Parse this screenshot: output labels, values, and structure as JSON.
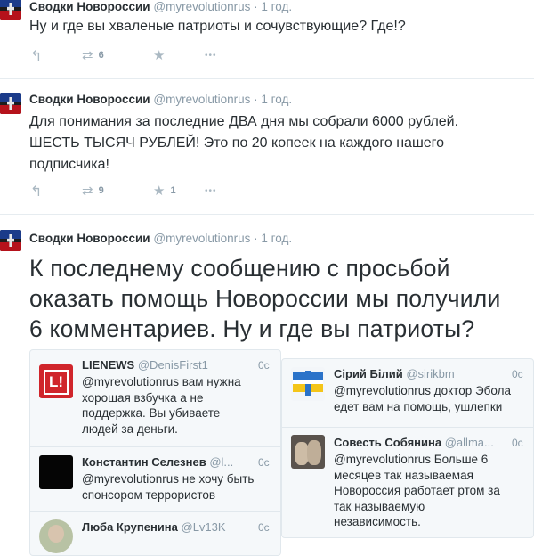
{
  "tweets": [
    {
      "name": "Сводки Новороссии",
      "handle": "@myrevolutionrus",
      "dot": "·",
      "time": "1 год.",
      "text": "Ну и где вы хваленые патриоты и сочувствующие? Где!?",
      "retweets": "6",
      "favorites": ""
    },
    {
      "name": "Сводки Новороссии",
      "handle": "@myrevolutionrus",
      "dot": "·",
      "time": "1 год.",
      "lines": [
        "Для понимания за последние ДВА дня мы собрали 6000 рублей.",
        "ШЕСТЬ ТЫСЯЧ РУБЛЕЙ! Это по 20 копеек на каждого нашего",
        "подписчика!"
      ],
      "retweets": "9",
      "favorites": "1"
    },
    {
      "name": "Сводки Новороссии",
      "handle": "@myrevolutionrus",
      "dot": "·",
      "time": "1 год.",
      "lines": [
        "К последнему сообщению с просьбой",
        "оказать помощь Новороссии мы получили",
        "6 комментариев. Ну и где вы патриоты?"
      ]
    }
  ],
  "icons": {
    "reply": "reply-icon",
    "retweet": "retweet-icon",
    "favorite": "star-icon",
    "more": "more-icon"
  },
  "glyphs": {
    "reply": "↰",
    "retweet": "⇄",
    "favorite": "★",
    "more": "•••"
  },
  "left_replies": [
    {
      "name": "LIENEWS",
      "handle": "@DenisFirst1",
      "time": "0с",
      "lines": [
        "@myrevolutionrus вам нужна",
        "хорошая взбучка а не",
        "поддержка. Вы убиваете",
        "людей за деньги."
      ],
      "avatar_text": "L!"
    },
    {
      "name": "Константин Селезнев",
      "handle": "@l...",
      "time": "0с",
      "lines": [
        "@myrevolutionrus не хочу быть",
        "спонсором террористов"
      ]
    },
    {
      "name": "Люба Крупенина",
      "handle": "@Lv13K",
      "time": "0с",
      "lines": []
    }
  ],
  "right_replies": [
    {
      "name": "Сірий Білий",
      "handle": "@sirikbm",
      "time": "0с",
      "lines": [
        "@myrevolutionrus доктор Эбола",
        "едет вам на помощь, ушлепки"
      ]
    },
    {
      "name": "Совесть Собянина",
      "handle": "@allma...",
      "time": "0с",
      "lines": [
        "@myrevolutionrus Больше 6",
        "месяцев так называемая",
        "Новороссия работает ртом за",
        "так называемую",
        "независимость."
      ]
    }
  ],
  "colors": {
    "text": "#292f33",
    "muted": "#8899a6",
    "action": "#aab8c2",
    "lienews_red": "#d0252b"
  }
}
